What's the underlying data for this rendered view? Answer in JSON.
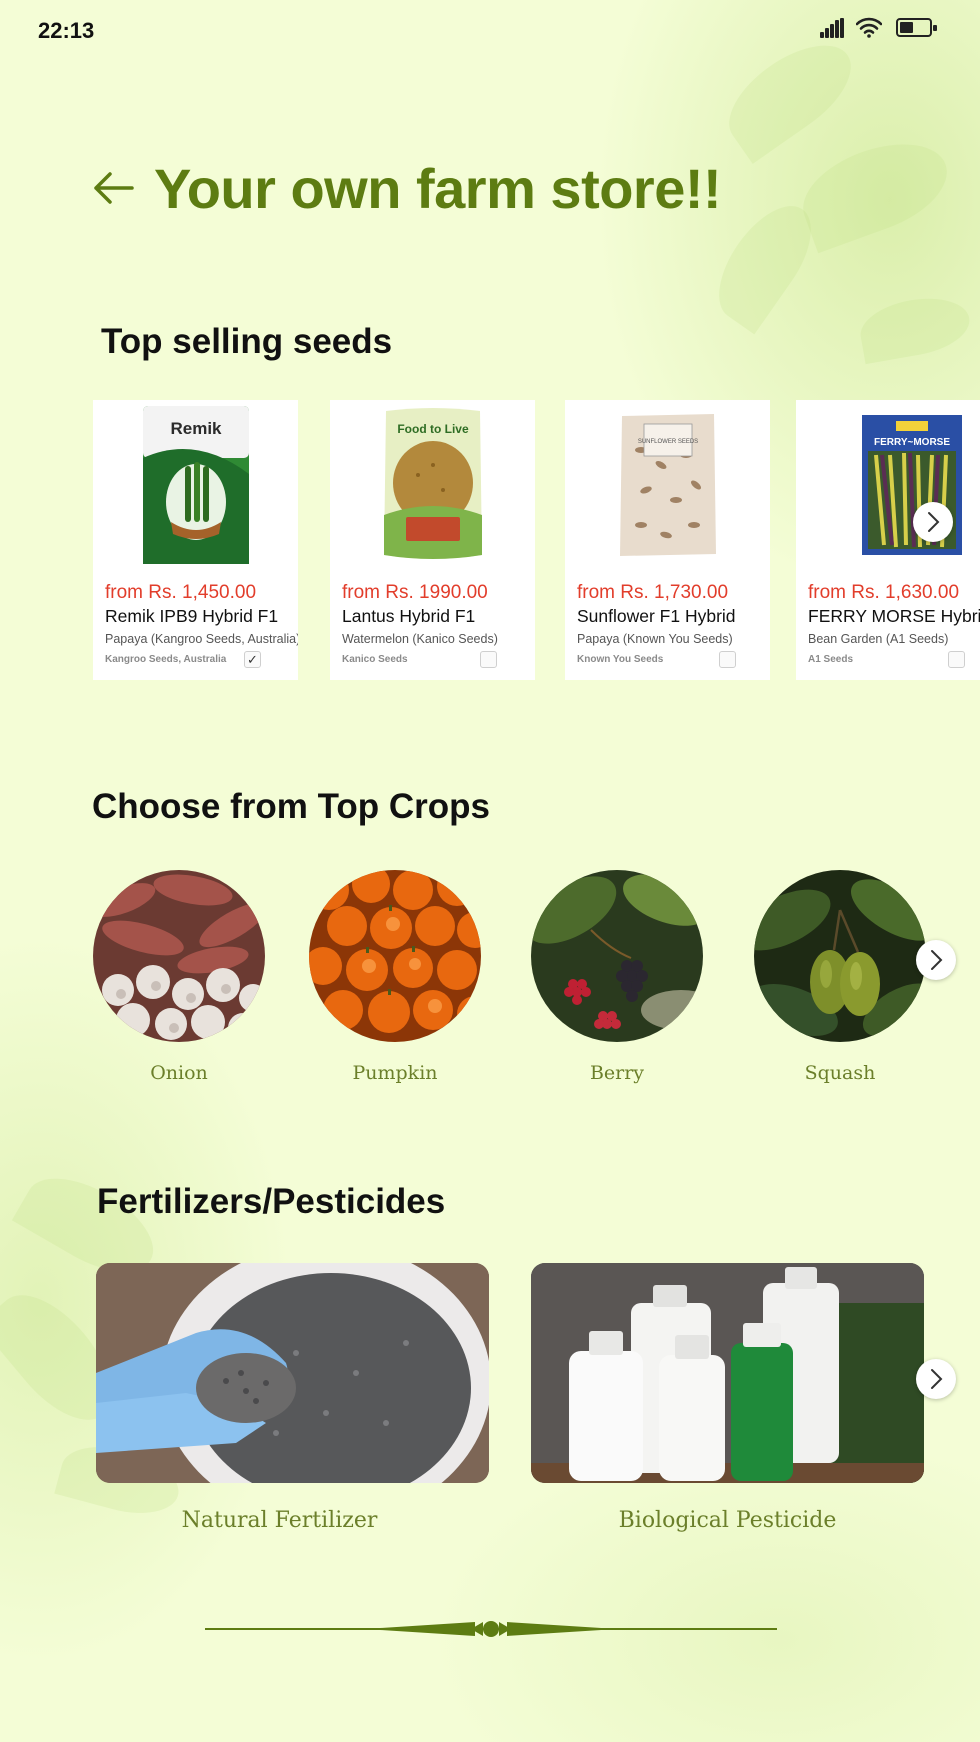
{
  "status_bar": {
    "time": "22:13",
    "battery_level": 0.45
  },
  "header": {
    "title": "Your own farm store!!",
    "back_icon": "arrow-left-icon"
  },
  "seeds": {
    "title": "Top selling seeds",
    "items": [
      {
        "price": "from Rs. 1,450.00",
        "name": "Remik IPB9 Hybrid F1",
        "subtitle": "Papaya (Kangroo Seeds, Australia)",
        "vendor": "Kangroo Seeds, Australia",
        "checked": true,
        "pack_brand": "Remik"
      },
      {
        "price": "from Rs. 1990.00",
        "name": "Lantus Hybrid F1",
        "subtitle": "Watermelon (Kanico Seeds)",
        "vendor": "Kanico Seeds",
        "checked": false,
        "pack_brand": "Food to Live"
      },
      {
        "price": "from Rs. 1,730.00",
        "name": "Sunflower F1 Hybrid",
        "subtitle": "Papaya (Known You Seeds)",
        "vendor": "Known You Seeds",
        "checked": false,
        "pack_brand": "SUNFLOWER SEEDS"
      },
      {
        "price": "from Rs. 1,630.00",
        "name": "FERRY MORSE Hybrid",
        "subtitle": "Bean Garden (A1 Seeds)",
        "vendor": "A1 Seeds",
        "checked": false,
        "pack_brand": "FERRY~MORSE"
      }
    ]
  },
  "crops": {
    "title": "Choose from Top Crops",
    "items": [
      {
        "label": "Onion"
      },
      {
        "label": "Pumpkin"
      },
      {
        "label": "Berry"
      },
      {
        "label": "Squash"
      }
    ]
  },
  "fertilizers": {
    "title": "Fertilizers/Pesticides",
    "items": [
      {
        "label": "Natural Fertilizer"
      },
      {
        "label": "Biological Pesticide"
      }
    ]
  },
  "colors": {
    "accent": "#5d7c12",
    "price": "#e23d2b",
    "background": "#f4fdd6",
    "label": "#6b7f2a"
  }
}
